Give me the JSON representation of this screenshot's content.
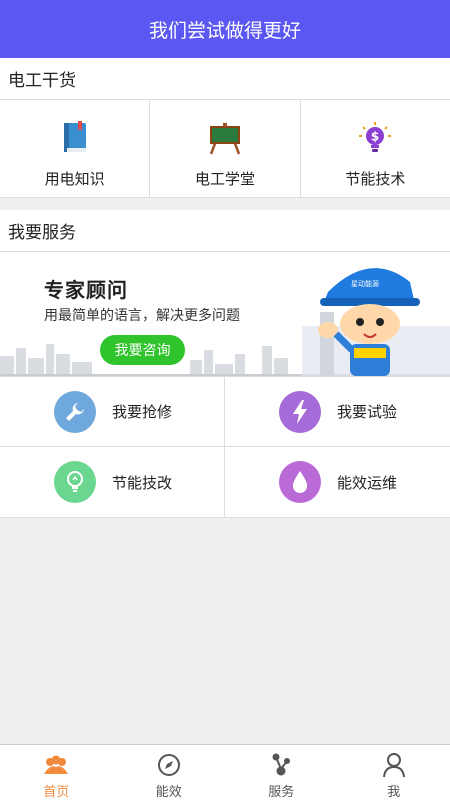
{
  "header": {
    "title": "我们尝试做得更好"
  },
  "sections": {
    "dry_goods": "电工干货",
    "services": "我要服务"
  },
  "tools": [
    {
      "label": "用电知识",
      "icon": "book-icon"
    },
    {
      "label": "电工学堂",
      "icon": "blackboard-icon"
    },
    {
      "label": "节能技术",
      "icon": "lightbulb-dollar-icon"
    }
  ],
  "banner": {
    "title": "专家顾问",
    "subtitle": "用最简单的语言，解决更多问题",
    "button": "我要咨询",
    "helmet_text": "星动能源"
  },
  "services": [
    {
      "label": "我要抢修",
      "icon": "wrench-icon",
      "color": "#6fa8dc"
    },
    {
      "label": "我要试验",
      "icon": "lightning-icon",
      "color": "#a66bd9"
    },
    {
      "label": "节能技改",
      "icon": "lightbulb-icon",
      "color": "#6bd68f"
    },
    {
      "label": "能效运维",
      "icon": "drop-icon",
      "color": "#b96ad6"
    }
  ],
  "tabbar": {
    "items": [
      {
        "label": "首页",
        "icon": "home-people-icon"
      },
      {
        "label": "能效",
        "icon": "compass-icon"
      },
      {
        "label": "服务",
        "icon": "network-icon"
      },
      {
        "label": "我",
        "icon": "user-icon"
      }
    ],
    "active_color": "#f08a3c"
  },
  "colors": {
    "header": "#5b57f2",
    "button_green": "#2fc42b"
  }
}
